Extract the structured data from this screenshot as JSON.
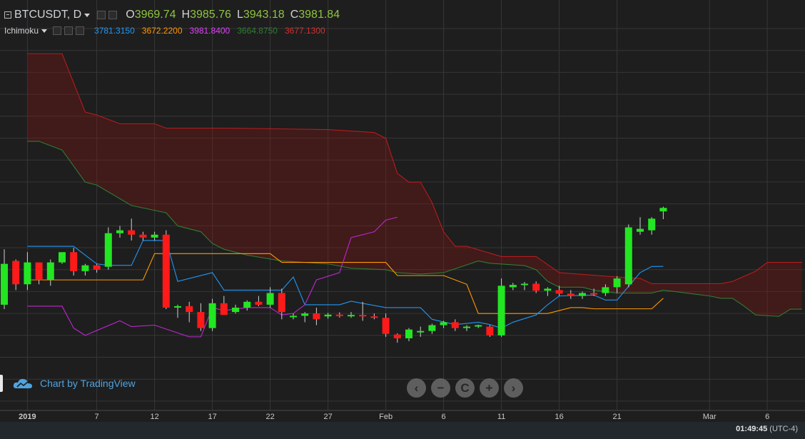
{
  "header": {
    "symbol": "BTCUSDT, D",
    "o_label": "O",
    "o_value": "3969.74",
    "h_label": "H",
    "h_value": "3985.76",
    "l_label": "L",
    "l_value": "3943.18",
    "c_label": "C",
    "c_value": "3981.84"
  },
  "indicator": {
    "name": "Ichimoku",
    "values": [
      {
        "text": "3781.3150",
        "color": "#2196f3"
      },
      {
        "text": "3672.2200",
        "color": "#ff9800"
      },
      {
        "text": "3981.8400",
        "color": "#e040fb"
      },
      {
        "text": "3664.8750",
        "color": "#2e7d32"
      },
      {
        "text": "3677.1300",
        "color": "#d32f2f"
      }
    ]
  },
  "watermark": "Chart by TradingView",
  "nav": [
    "‹",
    "−",
    "C",
    "+",
    "›"
  ],
  "clock": {
    "time": "01:49:45",
    "tz": "(UTC-4)"
  },
  "colors": {
    "up": "#22e622",
    "down": "#ff1a1a",
    "tenkan": "#2196f3",
    "kijun": "#ff9800",
    "chikou": "#c026d3",
    "spanA": "#2e7d32",
    "spanB": "#b71c1c",
    "cloud": "rgba(139,20,20,0.32)",
    "grid": "#363636",
    "bg": "#1e1e1e"
  },
  "chart_data": {
    "type": "candlestick",
    "ylim": [
      3300,
      4650
    ],
    "x_ticks": [
      {
        "label": "2019",
        "i": 2
      },
      {
        "label": "7",
        "i": 8
      },
      {
        "label": "12",
        "i": 13
      },
      {
        "label": "17",
        "i": 18
      },
      {
        "label": "22",
        "i": 23
      },
      {
        "label": "27",
        "i": 28
      },
      {
        "label": "Feb",
        "i": 33
      },
      {
        "label": "6",
        "i": 38
      },
      {
        "label": "11",
        "i": 43
      },
      {
        "label": "16",
        "i": 48
      },
      {
        "label": "21",
        "i": 53
      },
      {
        "label": "Mar",
        "i": 61
      },
      {
        "label": "6",
        "i": 66
      }
    ],
    "candles": [
      [
        3650,
        3840,
        3635,
        3790
      ],
      [
        3800,
        3805,
        3700,
        3720
      ],
      [
        3720,
        3830,
        3700,
        3795
      ],
      [
        3795,
        3795,
        3720,
        3735
      ],
      [
        3735,
        3805,
        3715,
        3795
      ],
      [
        3795,
        3830,
        3790,
        3830
      ],
      [
        3830,
        3845,
        3750,
        3765
      ],
      [
        3765,
        3790,
        3750,
        3785
      ],
      [
        3785,
        3790,
        3760,
        3770
      ],
      [
        3780,
        3915,
        3770,
        3895
      ],
      [
        3895,
        3920,
        3880,
        3905
      ],
      [
        3905,
        3945,
        3870,
        3890
      ],
      [
        3890,
        3900,
        3870,
        3880
      ],
      [
        3880,
        3900,
        3870,
        3890
      ],
      [
        3890,
        3905,
        3635,
        3640
      ],
      [
        3640,
        3650,
        3605,
        3645
      ],
      [
        3645,
        3660,
        3590,
        3625
      ],
      [
        3625,
        3655,
        3560,
        3570
      ],
      [
        3570,
        3670,
        3560,
        3655
      ],
      [
        3655,
        3680,
        3640,
        3615
      ],
      [
        3625,
        3650,
        3620,
        3640
      ],
      [
        3640,
        3665,
        3630,
        3660
      ],
      [
        3660,
        3680,
        3645,
        3650
      ],
      [
        3650,
        3710,
        3640,
        3690
      ],
      [
        3690,
        3705,
        3600,
        3625
      ],
      [
        3610,
        3620,
        3600,
        3612
      ],
      [
        3612,
        3625,
        3590,
        3620
      ],
      [
        3620,
        3640,
        3580,
        3600
      ],
      [
        3610,
        3622,
        3602,
        3616
      ],
      [
        3616,
        3624,
        3606,
        3612
      ],
      [
        3612,
        3625,
        3605,
        3615
      ],
      [
        3615,
        3660,
        3595,
        3610
      ],
      [
        3610,
        3620,
        3600,
        3605
      ],
      [
        3605,
        3620,
        3540,
        3550
      ],
      [
        3548,
        3552,
        3520,
        3535
      ],
      [
        3535,
        3570,
        3525,
        3565
      ],
      [
        3555,
        3575,
        3540,
        3560
      ],
      [
        3560,
        3585,
        3550,
        3580
      ],
      [
        3580,
        3595,
        3570,
        3590
      ],
      [
        3590,
        3600,
        3560,
        3570
      ],
      [
        3570,
        3580,
        3560,
        3575
      ],
      [
        3575,
        3582,
        3570,
        3580
      ],
      [
        3575,
        3580,
        3540,
        3545
      ],
      [
        3545,
        3740,
        3540,
        3715
      ],
      [
        3710,
        3725,
        3700,
        3718
      ],
      [
        3720,
        3728,
        3700,
        3722
      ],
      [
        3722,
        3730,
        3690,
        3698
      ],
      [
        3698,
        3710,
        3680,
        3705
      ],
      [
        3700,
        3715,
        3680,
        3688
      ],
      [
        3688,
        3700,
        3670,
        3680
      ],
      [
        3680,
        3695,
        3670,
        3690
      ],
      [
        3690,
        3705,
        3680,
        3685
      ],
      [
        3690,
        3720,
        3680,
        3710
      ],
      [
        3710,
        3748,
        3690,
        3740
      ],
      [
        3720,
        3925,
        3710,
        3915
      ],
      [
        3900,
        3950,
        3890,
        3910
      ],
      [
        3905,
        3950,
        3890,
        3945
      ],
      [
        3969.74,
        3985.76,
        3943.18,
        3981.84
      ]
    ],
    "tenkan": [
      [
        2,
        3850
      ],
      [
        6,
        3850
      ],
      [
        8,
        3790
      ],
      [
        9,
        3785
      ],
      [
        11,
        3785
      ],
      [
        12,
        3870
      ],
      [
        14,
        3870
      ],
      [
        15,
        3730
      ],
      [
        18,
        3760
      ],
      [
        19,
        3700
      ],
      [
        21,
        3700
      ],
      [
        24,
        3700
      ],
      [
        25,
        3745
      ],
      [
        26,
        3650
      ],
      [
        29,
        3650
      ],
      [
        30,
        3662
      ],
      [
        33,
        3640
      ],
      [
        36,
        3640
      ],
      [
        37,
        3600
      ],
      [
        39,
        3582
      ],
      [
        41,
        3590
      ],
      [
        42,
        3582
      ],
      [
        43,
        3570
      ],
      [
        44,
        3590
      ],
      [
        46,
        3615
      ],
      [
        47,
        3650
      ],
      [
        48,
        3680
      ],
      [
        51,
        3683
      ],
      [
        52,
        3666
      ],
      [
        53,
        3666
      ],
      [
        55,
        3760
      ],
      [
        56,
        3781
      ],
      [
        57,
        3781.315
      ]
    ],
    "kijun": [
      [
        2,
        3735
      ],
      [
        9,
        3735
      ],
      [
        12,
        3735
      ],
      [
        13,
        3825
      ],
      [
        23,
        3825
      ],
      [
        24,
        3795
      ],
      [
        33,
        3795
      ],
      [
        34,
        3750
      ],
      [
        38,
        3750
      ],
      [
        40,
        3720
      ],
      [
        41,
        3620
      ],
      [
        47,
        3620
      ],
      [
        49,
        3640
      ],
      [
        50,
        3640
      ],
      [
        51,
        3636
      ],
      [
        56,
        3636
      ],
      [
        57,
        3672.22
      ]
    ],
    "chikou": [
      [
        2,
        3645
      ],
      [
        5,
        3645
      ],
      [
        6,
        3570
      ],
      [
        7,
        3545
      ],
      [
        10,
        3595
      ],
      [
        11,
        3575
      ],
      [
        13,
        3580
      ],
      [
        16,
        3540
      ],
      [
        17,
        3540
      ],
      [
        18,
        3640
      ],
      [
        19,
        3630
      ],
      [
        21,
        3640
      ],
      [
        23,
        3640
      ],
      [
        24,
        3615
      ],
      [
        25,
        3620
      ],
      [
        26,
        3650
      ],
      [
        27,
        3735
      ],
      [
        29,
        3760
      ],
      [
        30,
        3880
      ],
      [
        32,
        3900
      ],
      [
        33,
        3940
      ],
      [
        34,
        3950
      ]
    ],
    "span_b": [
      [
        2,
        4510
      ],
      [
        3,
        4510
      ],
      [
        5,
        4510
      ],
      [
        7,
        4310
      ],
      [
        8,
        4300
      ],
      [
        10,
        4270
      ],
      [
        13,
        4270
      ],
      [
        14,
        4255
      ],
      [
        19,
        4255
      ],
      [
        23,
        4253
      ],
      [
        28,
        4250
      ],
      [
        32,
        4240
      ],
      [
        33,
        4220
      ],
      [
        34,
        4100
      ],
      [
        35,
        4070
      ],
      [
        36,
        4070
      ],
      [
        37,
        4000
      ],
      [
        38,
        3900
      ],
      [
        39,
        3850
      ],
      [
        40,
        3850
      ],
      [
        43,
        3815
      ],
      [
        46,
        3815
      ],
      [
        48,
        3760
      ],
      [
        53,
        3745
      ],
      [
        55,
        3740
      ],
      [
        56,
        3722
      ],
      [
        62,
        3722
      ],
      [
        63,
        3730
      ],
      [
        65,
        3765
      ],
      [
        66,
        3795
      ],
      [
        67,
        3795
      ],
      [
        69,
        3795
      ]
    ],
    "span_a": [
      [
        2,
        4210
      ],
      [
        3,
        4210
      ],
      [
        5,
        4180
      ],
      [
        7,
        4070
      ],
      [
        8,
        4060
      ],
      [
        11,
        3990
      ],
      [
        14,
        3965
      ],
      [
        15,
        3920
      ],
      [
        17,
        3900
      ],
      [
        18,
        3860
      ],
      [
        19,
        3840
      ],
      [
        21,
        3820
      ],
      [
        24,
        3800
      ],
      [
        26,
        3795
      ],
      [
        28,
        3790
      ],
      [
        30,
        3775
      ],
      [
        33,
        3770
      ],
      [
        34,
        3760
      ],
      [
        36,
        3755
      ],
      [
        38,
        3760
      ],
      [
        41,
        3800
      ],
      [
        42,
        3792
      ],
      [
        45,
        3784
      ],
      [
        46,
        3770
      ],
      [
        47,
        3730
      ],
      [
        48,
        3710
      ],
      [
        50,
        3710
      ],
      [
        51,
        3700
      ],
      [
        53,
        3690
      ],
      [
        56,
        3690
      ],
      [
        57,
        3700
      ],
      [
        60,
        3685
      ],
      [
        61,
        3680
      ],
      [
        62,
        3672
      ],
      [
        63,
        3672
      ],
      [
        64,
        3645
      ],
      [
        65,
        3615
      ],
      [
        67,
        3610
      ],
      [
        68,
        3635
      ],
      [
        69,
        3635
      ]
    ]
  }
}
